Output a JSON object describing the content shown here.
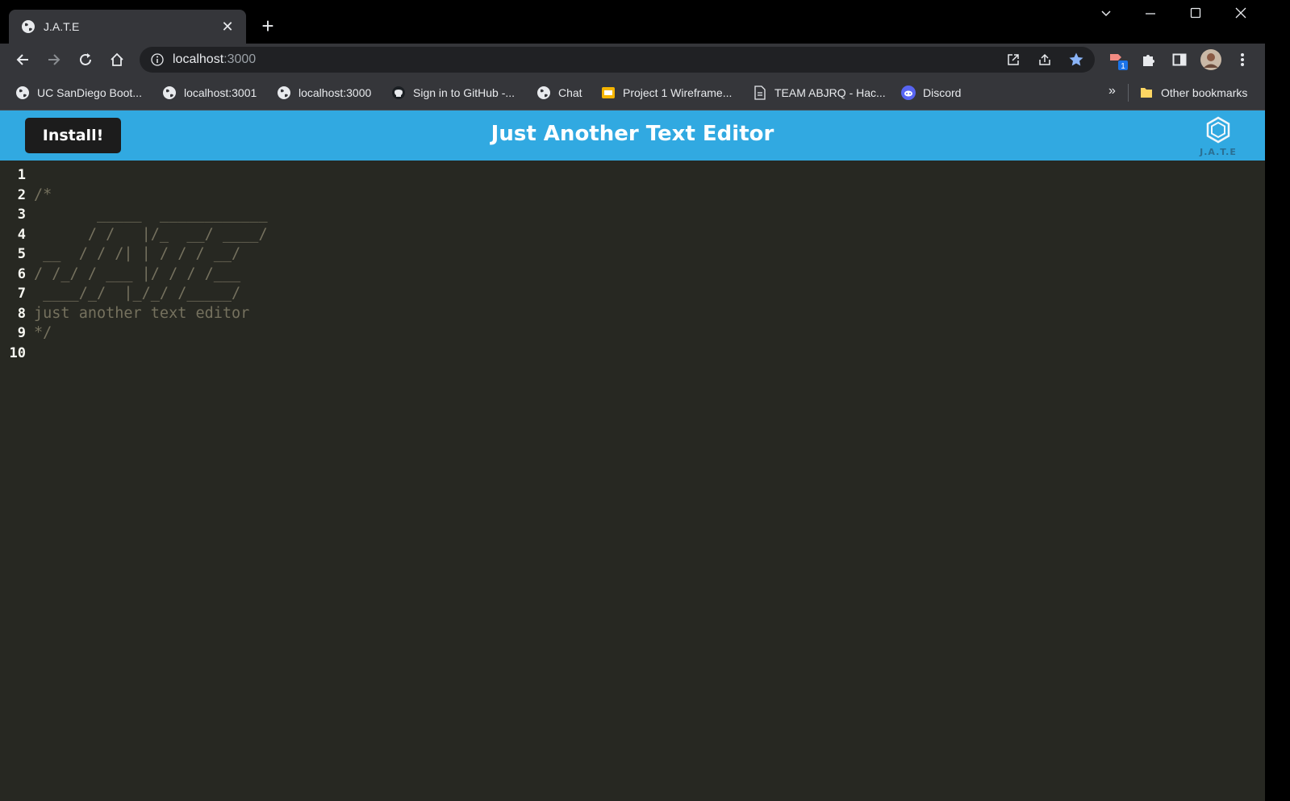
{
  "browser": {
    "tab": {
      "title": "J.A.T.E"
    },
    "address": {
      "host": "localhost",
      "port": ":3000"
    },
    "bookmarks": [
      {
        "label": "UC SanDiego Boot...",
        "icon": "globe-icon"
      },
      {
        "label": "localhost:3001",
        "icon": "globe-icon"
      },
      {
        "label": "localhost:3000",
        "icon": "globe-icon"
      },
      {
        "label": "Sign in to GitHub -...",
        "icon": "github-icon"
      },
      {
        "label": "Chat",
        "icon": "globe-icon"
      },
      {
        "label": "Project 1 Wireframe...",
        "icon": "slides-icon"
      },
      {
        "label": "TEAM ABJRQ - Hac...",
        "icon": "document-icon"
      },
      {
        "label": "Discord",
        "icon": "discord-icon"
      }
    ],
    "other_bookmarks": "Other bookmarks",
    "more_bookmarks": "»",
    "extension_badge": "1"
  },
  "app": {
    "install_label": "Install!",
    "title": "Just Another Text Editor",
    "logo_text": "J.A.T.E",
    "header_color": "#31a9e1",
    "editor_bg": "#272822"
  },
  "editor": {
    "line_numbers": [
      "1",
      "2",
      "3",
      "4",
      "5",
      "6",
      "7",
      "8",
      "9",
      "10"
    ],
    "lines": [
      "",
      "/*",
      "       _____  ____________",
      "      / /   |/_  __/ ____/",
      " __  / / /| | / / / __/",
      "/ /_/ / ___ |/ / / /___",
      " ____/_/  |_/_/ /_____/",
      "just another text editor",
      "*/",
      ""
    ]
  }
}
